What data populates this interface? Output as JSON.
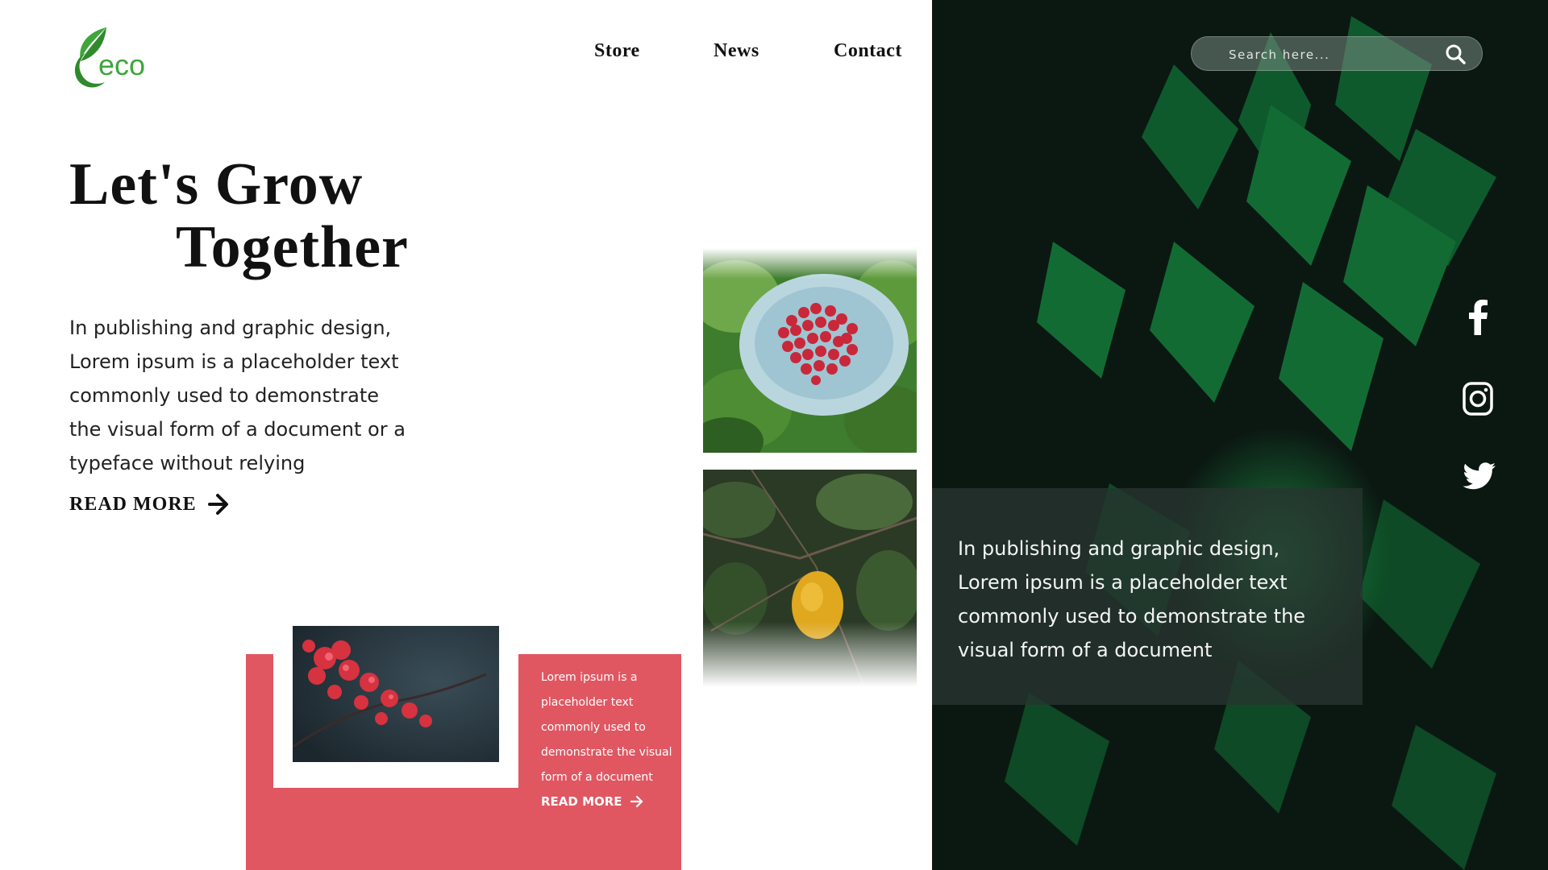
{
  "logo": {
    "text": "eco",
    "icon": "leaf-icon",
    "color": "#3ea63b"
  },
  "nav": {
    "store": "Store",
    "news": "News",
    "contact": "Contact"
  },
  "hero": {
    "title_line1": "Let's Grow",
    "title_line2": "Together",
    "description": "In publishing and graphic design, Lorem ipsum is a placeholder text commonly used to demonstrate the visual form of a document or a typeface without relying",
    "read_more": "READ MORE"
  },
  "card": {
    "text": "Lorem ipsum is a placeholder text commonly used to demonstrate the visual form of a document",
    "read_more": "READ MORE",
    "color": "#e05762"
  },
  "search": {
    "placeholder": "Search here..."
  },
  "social": {
    "icons": [
      "facebook-icon",
      "instagram-icon",
      "twitter-icon"
    ]
  },
  "panel": {
    "text": "In publishing and graphic design, Lorem ipsum is a placeholder text commonly used to demonstrate the visual form of a document"
  }
}
